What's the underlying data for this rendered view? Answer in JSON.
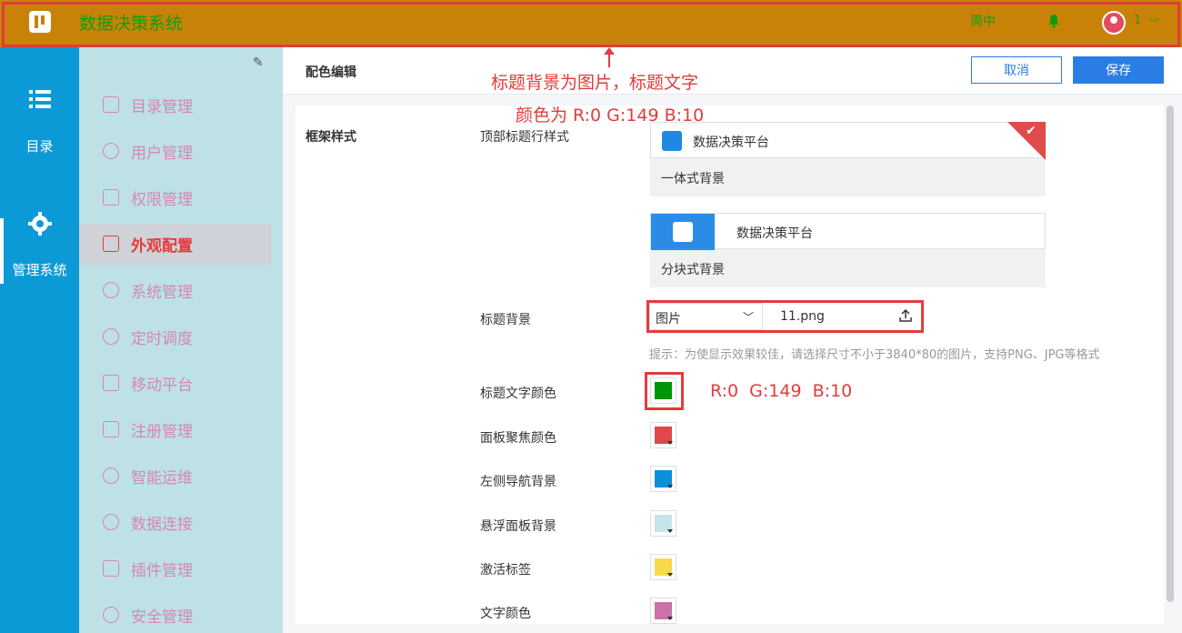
{
  "app": {
    "title": "数据决策系统",
    "language": "简中",
    "user": "1"
  },
  "rail": {
    "items": [
      {
        "label": "目录"
      },
      {
        "label": "管理系统"
      }
    ]
  },
  "sidebar": {
    "items": [
      {
        "label": "目录管理"
      },
      {
        "label": "用户管理"
      },
      {
        "label": "权限管理"
      },
      {
        "label": "外观配置",
        "active": true
      },
      {
        "label": "系统管理"
      },
      {
        "label": "定时调度"
      },
      {
        "label": "移动平台"
      },
      {
        "label": "注册管理"
      },
      {
        "label": "智能运维"
      },
      {
        "label": "数据连接"
      },
      {
        "label": "插件管理"
      },
      {
        "label": "安全管理"
      }
    ]
  },
  "header": {
    "title": "配色编辑",
    "cancel_label": "取消",
    "save_label": "保存"
  },
  "frame": {
    "section_title": "框架样式",
    "top_title_style_label": "顶部标题行样式",
    "platform_name": "数据决策平台",
    "integrated_caption": "一体式背景",
    "blocked_caption": "分块式背景",
    "title_bg_label": "标题背景",
    "title_bg_type": "图片",
    "title_bg_file": "11.png",
    "hint": "提示：为使显示效果较佳，请选择尺寸不小于3840*80的图片，支持PNG、JPG等格式"
  },
  "colors": [
    {
      "label": "标题文字颜色",
      "color": "#00950a"
    },
    {
      "label": "面板聚焦颜色",
      "color": "#e0484b"
    },
    {
      "label": "左侧导航背景",
      "color": "#0c8fdb"
    },
    {
      "label": "悬浮面板背景",
      "color": "#c6e4ea"
    },
    {
      "label": "激活标签",
      "color": "#f8d94a"
    },
    {
      "label": "文字颜色",
      "color": "#cc72a8"
    }
  ],
  "annotations": {
    "line1": "标题背景为图片，标题文字",
    "line2": "颜色为 R:0 G:149 B:10",
    "rgb": "R:0  G:149  B:10"
  },
  "theme": {
    "topbar": "#c98208",
    "title_text": "#139c12",
    "rail": "#0c9ad6",
    "sidebar": "#bee1e6",
    "sidebar_text": "#d587b4",
    "accent": "#2b7de3",
    "annotation": "#e23c3c"
  }
}
